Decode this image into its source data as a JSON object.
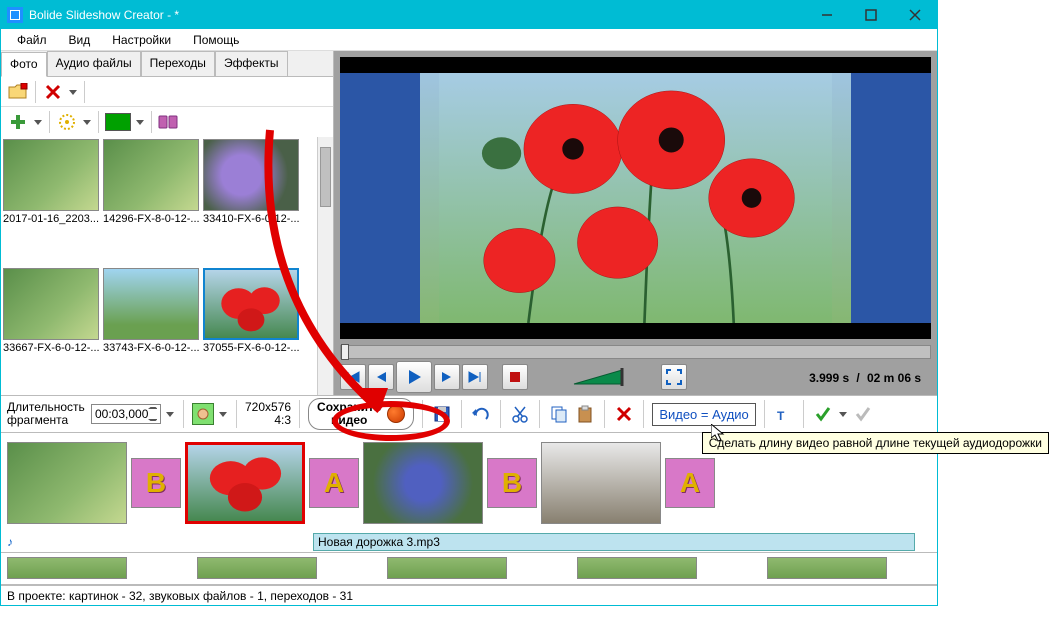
{
  "window": {
    "title": "Bolide Slideshow Creator - *"
  },
  "menu": {
    "file": "Файл",
    "view": "Вид",
    "settings": "Настройки",
    "help": "Помощь"
  },
  "tabs": {
    "photo": "Фото",
    "audio": "Аудио файлы",
    "transitions": "Переходы",
    "effects": "Эффекты"
  },
  "thumbs": [
    {
      "name": "2017-01-16_2203..."
    },
    {
      "name": "14296-FX-8-0-12-..."
    },
    {
      "name": "33410-FX-6-0-12-..."
    },
    {
      "name": "33667-FX-6-0-12-..."
    },
    {
      "name": "33743-FX-6-0-12-..."
    },
    {
      "name": "37055-FX-6-0-12-..."
    }
  ],
  "duration": {
    "label": "Длительность\nфрагмента",
    "value": "00:03,000"
  },
  "res": {
    "size": "720x576",
    "ratio": "4:3"
  },
  "save": {
    "label": "Сохранить\nвидео"
  },
  "va_button": "Видео = Аудио",
  "tooltip": "Сделать длину видео равной длине текущей аудиодорожки",
  "time": {
    "cur": "3.999 s",
    "sep": "/",
    "total": "02 m 06 s"
  },
  "audio_track": "Новая дорожка 3.mp3",
  "status": "В проекте: картинок - 32, звуковых файлов - 1, переходов - 31",
  "trans_letter": {
    "b": "B",
    "a": "A"
  }
}
